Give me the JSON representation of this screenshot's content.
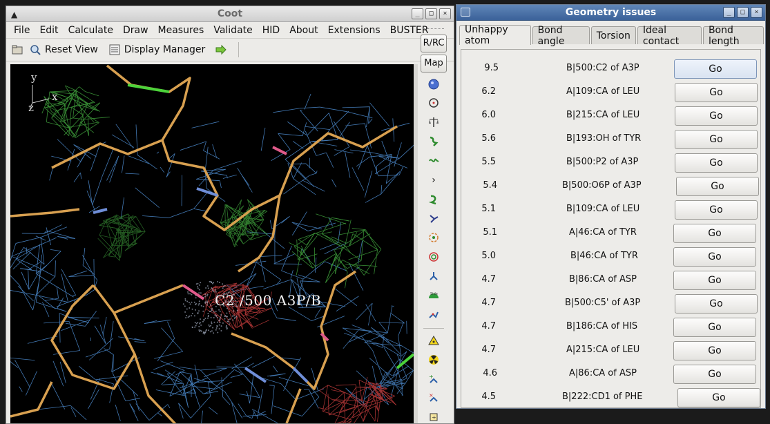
{
  "coot": {
    "title": "Coot",
    "menu": [
      "File",
      "Edit",
      "Calculate",
      "Draw",
      "Measures",
      "Validate",
      "HID",
      "About",
      "Extensions",
      "BUSTER"
    ],
    "toolbar": {
      "reset_view": "Reset View",
      "display_manager": "Display Manager"
    },
    "side_buttons": {
      "rrc": "R/RC",
      "map": "Map"
    },
    "viewport": {
      "atom_label": "C2 /500 A3P/B",
      "axes": {
        "y": "y",
        "x": "x",
        "z": "z"
      }
    }
  },
  "geometry": {
    "title": "Geometry issues",
    "tabs": [
      "Unhappy atom",
      "Bond angle",
      "Torsion",
      "Ideal contact",
      "Bond length"
    ],
    "active_tab": "Unhappy atom",
    "go_label": "Go",
    "rows": [
      {
        "score": "9.5",
        "atom": "B|500:C2 of A3P"
      },
      {
        "score": "6.2",
        "atom": "A|109:CA of LEU"
      },
      {
        "score": "6.0",
        "atom": "B|215:CA of LEU"
      },
      {
        "score": "5.6",
        "atom": "B|193:OH of TYR"
      },
      {
        "score": "5.5",
        "atom": "B|500:P2 of A3P"
      },
      {
        "score": "5.4",
        "atom": "B|500:O6P of A3P"
      },
      {
        "score": "5.1",
        "atom": "B|109:CA of LEU"
      },
      {
        "score": "5.1",
        "atom": "A|46:CA of TYR"
      },
      {
        "score": "5.0",
        "atom": "B|46:CA of TYR"
      },
      {
        "score": "4.7",
        "atom": "B|86:CA of ASP"
      },
      {
        "score": "4.7",
        "atom": "B|500:C5' of A3P"
      },
      {
        "score": "4.7",
        "atom": "B|186:CA of HIS"
      },
      {
        "score": "4.7",
        "atom": "A|215:CA of LEU"
      },
      {
        "score": "4.6",
        "atom": "A|86:CA of ASP"
      },
      {
        "score": "4.5",
        "atom": "B|222:CD1 of PHE"
      }
    ]
  },
  "colors": {
    "mesh_blue": "#4f8fd4",
    "mesh_green": "#3d9a3a",
    "mesh_red": "#b43838",
    "bond_tan": "#d8a050",
    "title_blue": "#3b6199"
  }
}
